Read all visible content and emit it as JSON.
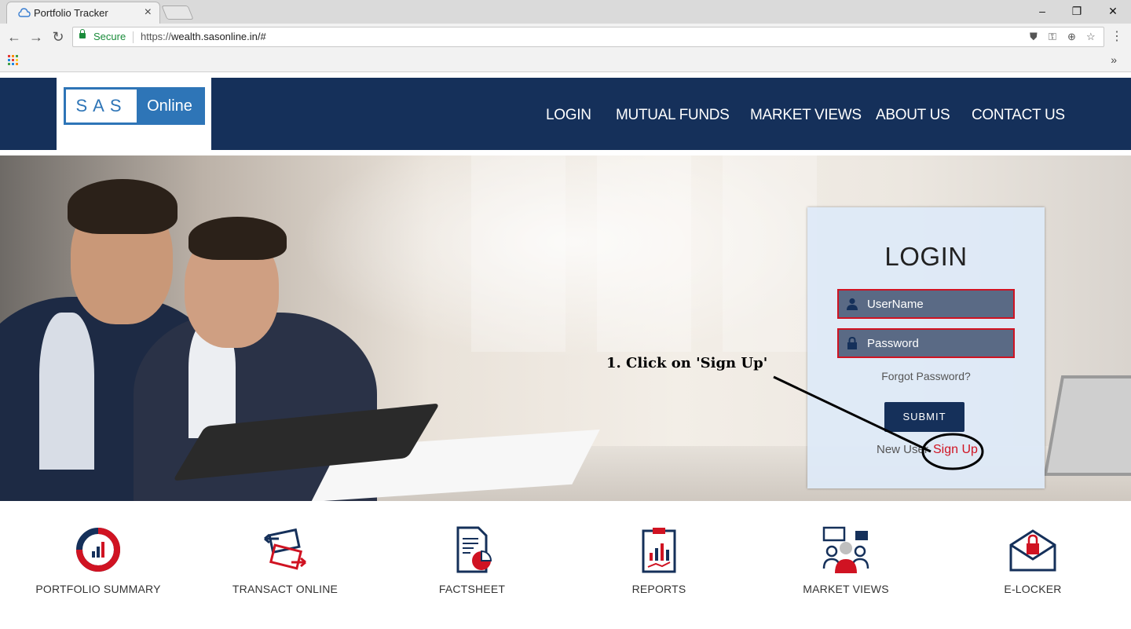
{
  "browser": {
    "tab_title": "Portfolio Tracker",
    "tab_close": "×",
    "secure_label": "Secure",
    "url_scheme": "https://",
    "url_rest": "wealth.sasonline.in/#",
    "window_controls": [
      "–",
      "❐",
      "✕"
    ],
    "bookmarks_more": "»"
  },
  "site": {
    "logo_left": "SAS",
    "logo_right": "Online",
    "nav": [
      "LOGIN",
      "MUTUAL FUNDS",
      "MARKET VIEWS",
      "ABOUT US",
      "CONTACT US"
    ]
  },
  "login": {
    "title": "LOGIN",
    "username_placeholder": "UserName",
    "password_placeholder": "Password",
    "forgot": "Forgot Password?",
    "submit": "SUBMIT",
    "new_user": "New User",
    "signup": "Sign Up"
  },
  "annotation": {
    "text": "1. Click on 'Sign Up'"
  },
  "features": [
    {
      "label": "PORTFOLIO SUMMARY",
      "icon": "portfolio-summary-icon"
    },
    {
      "label": "TRANSACT ONLINE",
      "icon": "transact-online-icon"
    },
    {
      "label": "FACTSHEET",
      "icon": "factsheet-icon"
    },
    {
      "label": "REPORTS",
      "icon": "reports-icon"
    },
    {
      "label": "MARKET VIEWS",
      "icon": "market-views-icon"
    },
    {
      "label": "E-LOCKER",
      "icon": "e-locker-icon"
    }
  ],
  "colors": {
    "header_navy": "#15305a",
    "logo_blue": "#2e75b7",
    "accent_red": "#d01322",
    "secure_green": "#1a8c3b"
  }
}
